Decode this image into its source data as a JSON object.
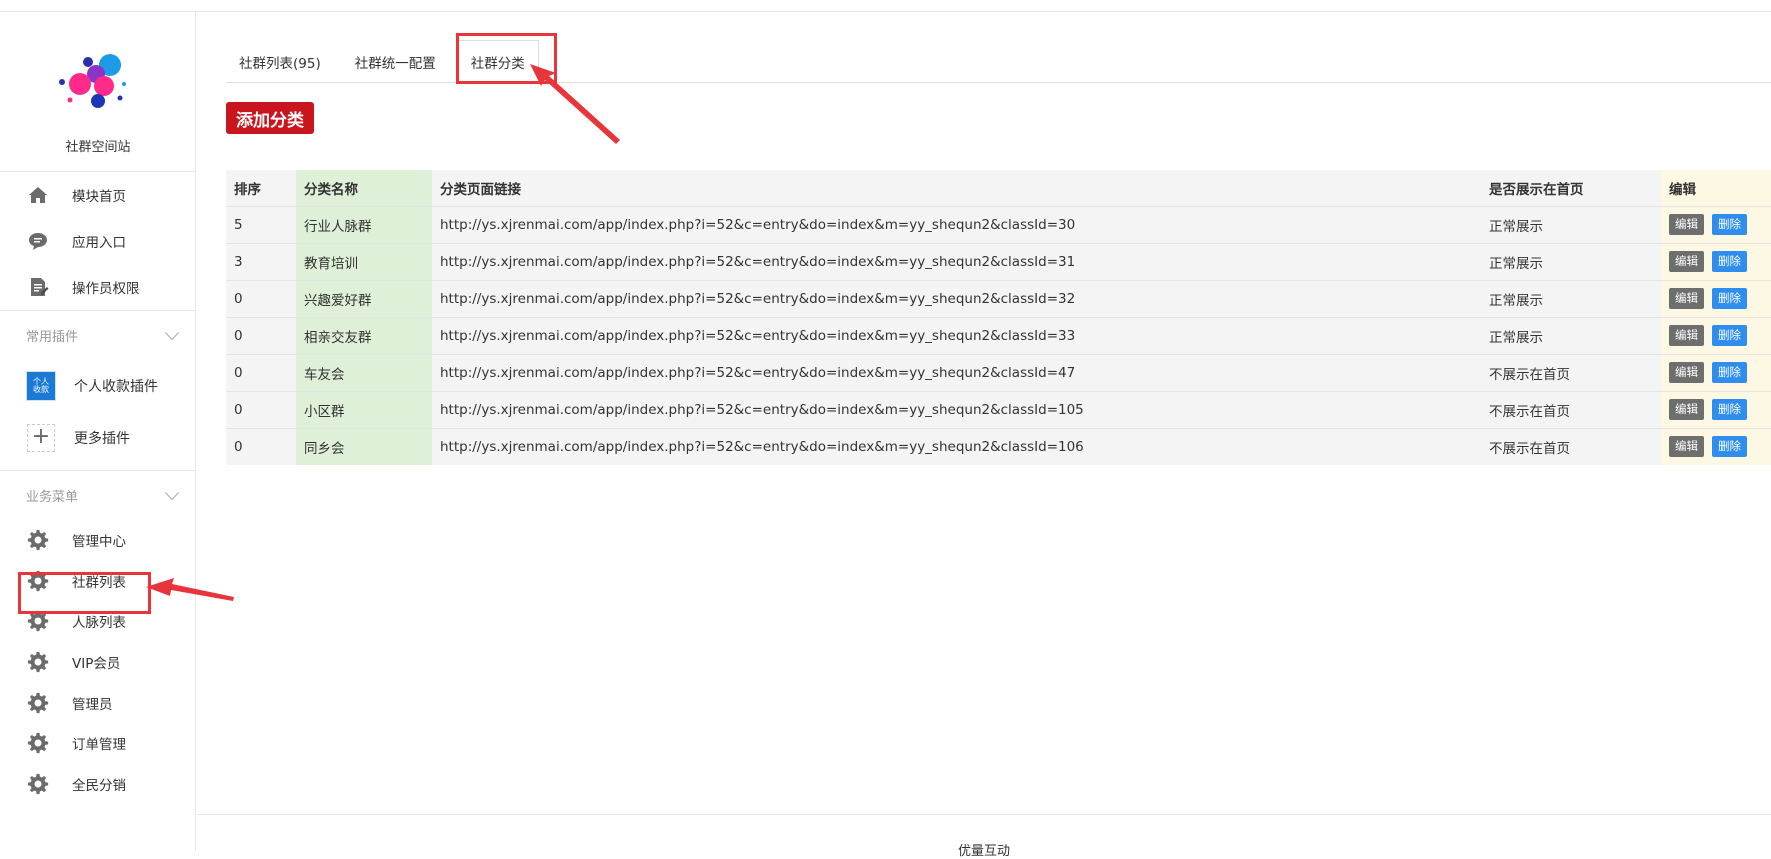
{
  "sidebar": {
    "site_name": "社群空间站",
    "main_items": [
      {
        "label": "模块首页",
        "icon": "home-icon"
      },
      {
        "label": "应用入口",
        "icon": "chat-bubble-icon"
      },
      {
        "label": "操作员权限",
        "icon": "document-edit-icon"
      }
    ],
    "plugins_section": {
      "title": "常用插件"
    },
    "plugins": [
      {
        "label": "个人收款插件",
        "icon": "payment-plugin-icon",
        "thumb_lines": [
          "个人",
          "收款"
        ]
      },
      {
        "label": "更多插件",
        "icon": "plus-icon"
      }
    ],
    "business_section": {
      "title": "业务菜单"
    },
    "business_items": [
      {
        "label": "管理中心",
        "icon": "gear-icon"
      },
      {
        "label": "社群列表",
        "icon": "gear-icon"
      },
      {
        "label": "人脉列表",
        "icon": "gear-icon"
      },
      {
        "label": "VIP会员",
        "icon": "gear-icon"
      },
      {
        "label": "管理员",
        "icon": "gear-icon"
      },
      {
        "label": "订单管理",
        "icon": "gear-icon"
      },
      {
        "label": "全民分销",
        "icon": "gear-icon"
      }
    ]
  },
  "tabs": [
    {
      "label": "社群列表(95)"
    },
    {
      "label": "社群统一配置"
    },
    {
      "label": "社群分类",
      "active": true
    }
  ],
  "add_button": "添加分类",
  "table": {
    "headers": [
      "排序",
      "分类名称",
      "分类页面链接",
      "是否展示在首页",
      "编辑"
    ],
    "edit_label": "编辑",
    "delete_label": "删除",
    "rows": [
      {
        "order": "5",
        "name": "行业人脉群",
        "link": "http://ys.xjrenmai.com/app/index.php?i=52&c=entry&do=index&m=yy_shequn2&classId=30",
        "show": "正常展示"
      },
      {
        "order": "3",
        "name": "教育培训",
        "link": "http://ys.xjrenmai.com/app/index.php?i=52&c=entry&do=index&m=yy_shequn2&classId=31",
        "show": "正常展示"
      },
      {
        "order": "0",
        "name": "兴趣爱好群",
        "link": "http://ys.xjrenmai.com/app/index.php?i=52&c=entry&do=index&m=yy_shequn2&classId=32",
        "show": "正常展示"
      },
      {
        "order": "0",
        "name": "相亲交友群",
        "link": "http://ys.xjrenmai.com/app/index.php?i=52&c=entry&do=index&m=yy_shequn2&classId=33",
        "show": "正常展示"
      },
      {
        "order": "0",
        "name": "车友会",
        "link": "http://ys.xjrenmai.com/app/index.php?i=52&c=entry&do=index&m=yy_shequn2&classId=47",
        "show": "不展示在首页"
      },
      {
        "order": "0",
        "name": "小区群",
        "link": "http://ys.xjrenmai.com/app/index.php?i=52&c=entry&do=index&m=yy_shequn2&classId=105",
        "show": "不展示在首页"
      },
      {
        "order": "0",
        "name": "同乡会",
        "link": "http://ys.xjrenmai.com/app/index.php?i=52&c=entry&do=index&m=yy_shequn2&classId=106",
        "show": "不展示在首页"
      }
    ]
  },
  "footer": {
    "text": "优量互动"
  },
  "colors": {
    "accent_red": "#c9151e",
    "annotation_red": "#e8353b",
    "delete_blue": "#2e8ded",
    "edit_gray": "#6e6e6e",
    "green_cell": "#dff0d8",
    "yellow_cell": "#fcf8e3"
  }
}
